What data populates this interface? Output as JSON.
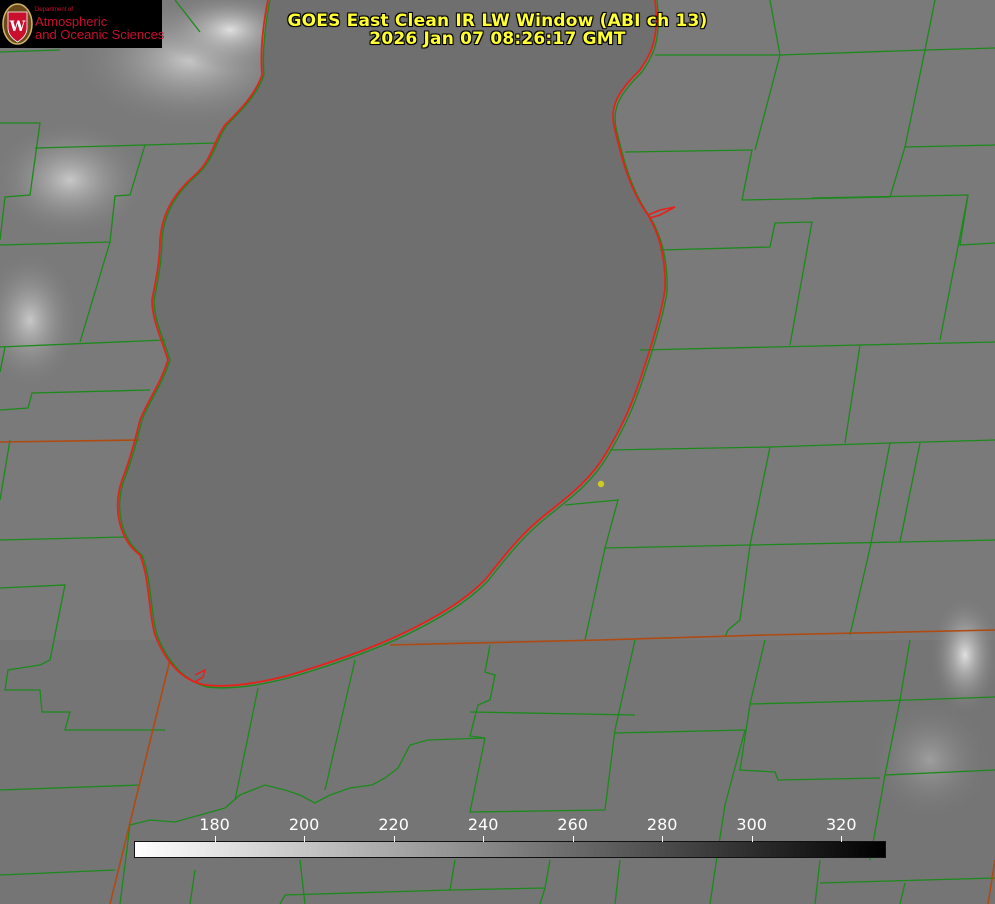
{
  "title": {
    "line1": "GOES East Clean IR LW Window (ABI ch 13)",
    "line2": "2026 Jan 07 08:26:17 GMT",
    "color": "#ffff33"
  },
  "logo": {
    "dept": "Department of",
    "line1": "Atmospheric",
    "line2": "and Oceanic Sciences",
    "text_color": "#c8102e",
    "seal_letter": "W"
  },
  "colorbar": {
    "min": 162,
    "max": 330,
    "ticks": [
      180,
      200,
      220,
      240,
      260,
      280,
      300,
      320
    ],
    "gradient": [
      "#ffffff",
      "#000000"
    ]
  },
  "colors": {
    "county_lines": "#1b8a1b",
    "state_lines": "#b04a10",
    "lake_shoreline": "#e8201a",
    "base_gray": "#7a7a7a",
    "marker": "#cccc22"
  },
  "icons": [
    "uw-seal-icon",
    "location-marker-icon"
  ]
}
